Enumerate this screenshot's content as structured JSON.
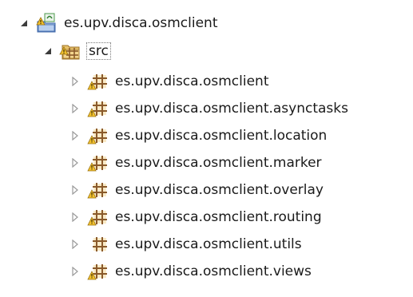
{
  "tree": {
    "project": {
      "label": "es.upv.disca.osmclient",
      "expanded": true,
      "icon": "java-project-icon"
    },
    "source_folder": {
      "label": "src",
      "expanded": true,
      "icon": "source-folder-icon"
    },
    "packages": [
      {
        "label": "es.upv.disca.osmclient",
        "warning": true
      },
      {
        "label": "es.upv.disca.osmclient.asynctasks",
        "warning": true
      },
      {
        "label": "es.upv.disca.osmclient.location",
        "warning": true
      },
      {
        "label": "es.upv.disca.osmclient.marker",
        "warning": true
      },
      {
        "label": "es.upv.disca.osmclient.overlay",
        "warning": true
      },
      {
        "label": "es.upv.disca.osmclient.routing",
        "warning": true
      },
      {
        "label": "es.upv.disca.osmclient.utils",
        "warning": false
      },
      {
        "label": "es.upv.disca.osmclient.views",
        "warning": true
      }
    ]
  },
  "colors": {
    "package_brown": "#8a5a2b",
    "package_fill": "#d9a55b",
    "warning_yellow": "#f2c12e",
    "expanded_arrow": "#3c3c3c",
    "collapsed_arrow": "#9a9a9a"
  }
}
